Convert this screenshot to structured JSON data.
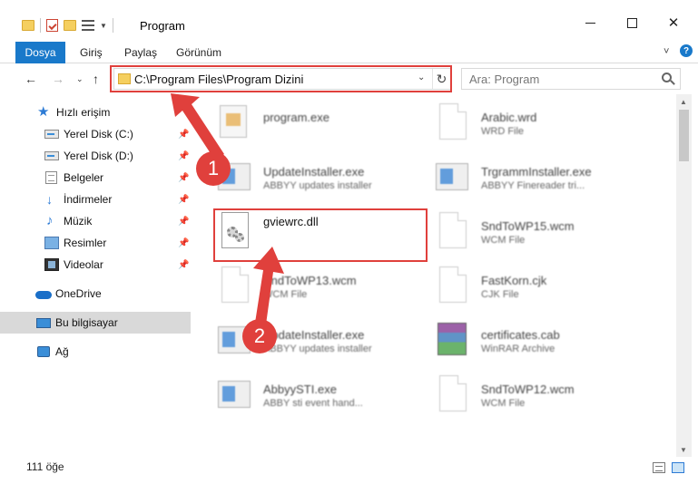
{
  "window": {
    "title": "Program",
    "controls": {
      "minimize": "minimize",
      "maximize": "maximize",
      "close": "✕"
    }
  },
  "ribbon": {
    "file_tab": "Dosya",
    "tabs": [
      "Giriş",
      "Paylaş",
      "Görünüm"
    ],
    "expand": "˅",
    "help": "?"
  },
  "nav": {
    "back": "←",
    "forward": "→",
    "recent": "⌄",
    "up": "↑",
    "address": "C:\\Program Files\\Program Dizini",
    "address_chevron": "⌄",
    "refresh": "↻",
    "search_placeholder": "Ara: Program"
  },
  "sidebar": {
    "items": [
      {
        "label": "Hızlı erişim",
        "icon": "star-icon"
      },
      {
        "label": "Yerel Disk (C:)",
        "icon": "drive-icon",
        "pinned": true
      },
      {
        "label": "Yerel Disk (D:)",
        "icon": "drive-icon",
        "pinned": true
      },
      {
        "label": "Belgeler",
        "icon": "documents-icon",
        "pinned": true
      },
      {
        "label": "İndirmeler",
        "icon": "download-icon",
        "pinned": true
      },
      {
        "label": "Müzik",
        "icon": "music-icon",
        "pinned": true
      },
      {
        "label": "Resimler",
        "icon": "pictures-icon",
        "pinned": true
      },
      {
        "label": "Videolar",
        "icon": "videos-icon",
        "pinned": true
      },
      {
        "label": "OneDrive",
        "icon": "onedrive-icon"
      },
      {
        "label": "Bu bilgisayar",
        "icon": "this-pc-icon",
        "selected": true
      },
      {
        "label": "Ağ",
        "icon": "network-icon"
      }
    ],
    "pin_glyph": "📌"
  },
  "files": [
    {
      "name": "program.exe",
      "type": "",
      "icon": "exe-icon"
    },
    {
      "name": "Arabic.wrd",
      "type": "WRD File",
      "icon": "document-icon"
    },
    {
      "name": "UpdateInstaller.exe",
      "type": "ABBYY updates installer",
      "icon": "app-icon"
    },
    {
      "name": "TrgrammInstaller.exe",
      "type": "ABBYY Finereader tri...",
      "icon": "app-icon"
    },
    {
      "name": "gviewrc.dll",
      "type": "",
      "icon": "dll-icon"
    },
    {
      "name": "SndToWP15.wcm",
      "type": "WCM File",
      "icon": "document-icon"
    },
    {
      "name": "SndToWP13.wcm",
      "type": "WCM File",
      "icon": "document-icon"
    },
    {
      "name": "FastKorn.cjk",
      "type": "CJK File",
      "icon": "document-icon"
    },
    {
      "name": "UpdateInstaller.exe",
      "type": "ABBYY updates installer",
      "icon": "app-icon"
    },
    {
      "name": "certificates.cab",
      "type": "WinRAR Archive",
      "icon": "winrar-icon"
    },
    {
      "name": "AbbyySTI.exe",
      "type": "ABBY sti event hand...",
      "icon": "app-icon"
    },
    {
      "name": "SndToWP12.wcm",
      "type": "WCM File",
      "icon": "document-icon"
    }
  ],
  "status": {
    "count": "111 öğe"
  },
  "scrollbar": {
    "up": "▲",
    "down": "▼"
  },
  "annotations": {
    "step1": "1",
    "step2": "2",
    "color": "#e0403c"
  }
}
